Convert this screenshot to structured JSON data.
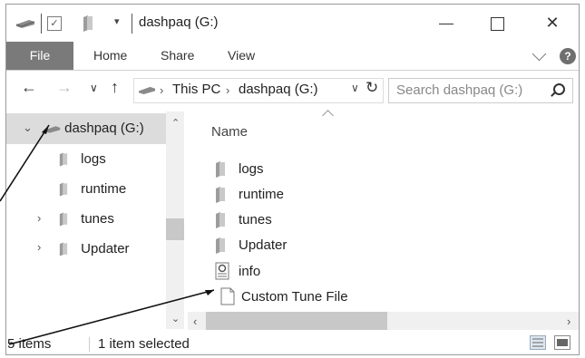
{
  "window": {
    "title": "dashpaq (G:)",
    "quick_access_dropdown": "▾",
    "controls": {
      "close": "✕"
    }
  },
  "ribbon": {
    "tabs": [
      "File",
      "Home",
      "Share",
      "View"
    ],
    "help": "?"
  },
  "address": {
    "crumbs": [
      "This PC",
      "dashpaq (G:)"
    ],
    "search_placeholder": "Search dashpaq (G:)"
  },
  "nav_pane": {
    "items": [
      {
        "label": "dashpaq  (G:)",
        "expanded": true,
        "selected": true
      },
      {
        "label": "logs"
      },
      {
        "label": "runtime"
      },
      {
        "label": "tunes",
        "collapsed": true
      },
      {
        "label": "Updater",
        "collapsed": true
      }
    ]
  },
  "content": {
    "column_header": "Name",
    "files": [
      {
        "name": "logs",
        "icon": "folder-icon"
      },
      {
        "name": "runtime",
        "icon": "folder-icon"
      },
      {
        "name": "tunes",
        "icon": "folder-icon"
      },
      {
        "name": "Updater",
        "icon": "folder-icon"
      },
      {
        "name": "info",
        "icon": "settings-file-icon"
      },
      {
        "name": "Custom Tune File",
        "icon": "blank-file-icon",
        "selected": true
      }
    ]
  },
  "status": {
    "count": "5 items",
    "selection": "1 item selected"
  },
  "colors": {
    "file_tab": "#7a7a7a",
    "selected_tree": "#dcdcdc",
    "scroll_thumb": "#c8c8c8"
  }
}
